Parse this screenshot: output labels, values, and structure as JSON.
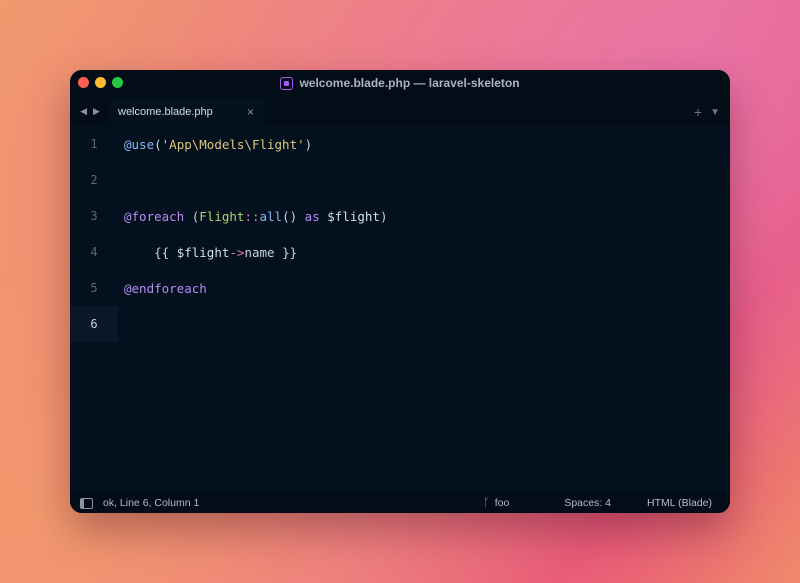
{
  "window": {
    "title": "welcome.blade.php — laravel-skeleton"
  },
  "tabs": [
    {
      "label": "welcome.blade.php",
      "close": "×"
    }
  ],
  "editor": {
    "current_line": 6,
    "line_numbers": [
      "1",
      "2",
      "3",
      "4",
      "5",
      "6"
    ]
  },
  "status": {
    "position": "ok, Line 6, Column 1",
    "branch": "foo",
    "spaces": "Spaces: 4",
    "syntax": "HTML (Blade)"
  },
  "colors": {
    "keyword": "#b88cf2",
    "string": "#e0c77a",
    "class": "#a9d46f",
    "function": "#8bb7f5",
    "editor_bg": "#03111f"
  }
}
